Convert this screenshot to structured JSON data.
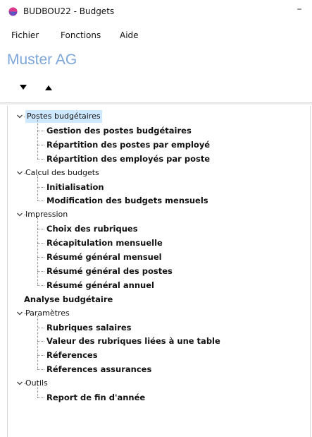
{
  "window": {
    "title": "BUDBOU22 - Budgets",
    "minimize_glyph": "–",
    "icon": "app-logo-icon"
  },
  "menu": {
    "items": [
      {
        "label": "Fichier"
      },
      {
        "label": "Fonctions"
      },
      {
        "label": "Aide"
      }
    ]
  },
  "company": {
    "name": "Muster AG",
    "color": "#7ea6d8"
  },
  "toolbar": {
    "buttons": [
      {
        "icon": "triangle-down-icon"
      },
      {
        "icon": "triangle-up-icon"
      }
    ]
  },
  "tree": {
    "groups": [
      {
        "label": "Postes budgétaires",
        "selected": true,
        "children": [
          {
            "label": "Gestion des postes budgétaires"
          },
          {
            "label": "Répartition des postes par employé"
          },
          {
            "label": "Répartition des employés par poste"
          }
        ]
      },
      {
        "label": "Calcul des budgets",
        "children": [
          {
            "label": "Initialisation"
          },
          {
            "label": "Modification des budgets mensuels"
          }
        ]
      },
      {
        "label": "Impression",
        "children": [
          {
            "label": "Choix des rubriques"
          },
          {
            "label": "Récapitulation mensuelle"
          },
          {
            "label": "Résumé général mensuel"
          },
          {
            "label": "Résumé général des postes"
          },
          {
            "label": "Résumé général annuel"
          }
        ]
      },
      {
        "label": "Analyse budgétaire",
        "leaf": true
      },
      {
        "label": "Paramètres",
        "children": [
          {
            "label": "Rubriques salaires"
          },
          {
            "label": "Valeur des rubriques liées à une table"
          },
          {
            "label": "Réferences"
          },
          {
            "label": "Réferences assurances"
          }
        ]
      },
      {
        "label": "Outils",
        "children": [
          {
            "label": "Report de fin d'année"
          }
        ]
      }
    ]
  },
  "colors": {
    "selection": "#cde8ff",
    "tree_lines": "#8a8a8a"
  }
}
